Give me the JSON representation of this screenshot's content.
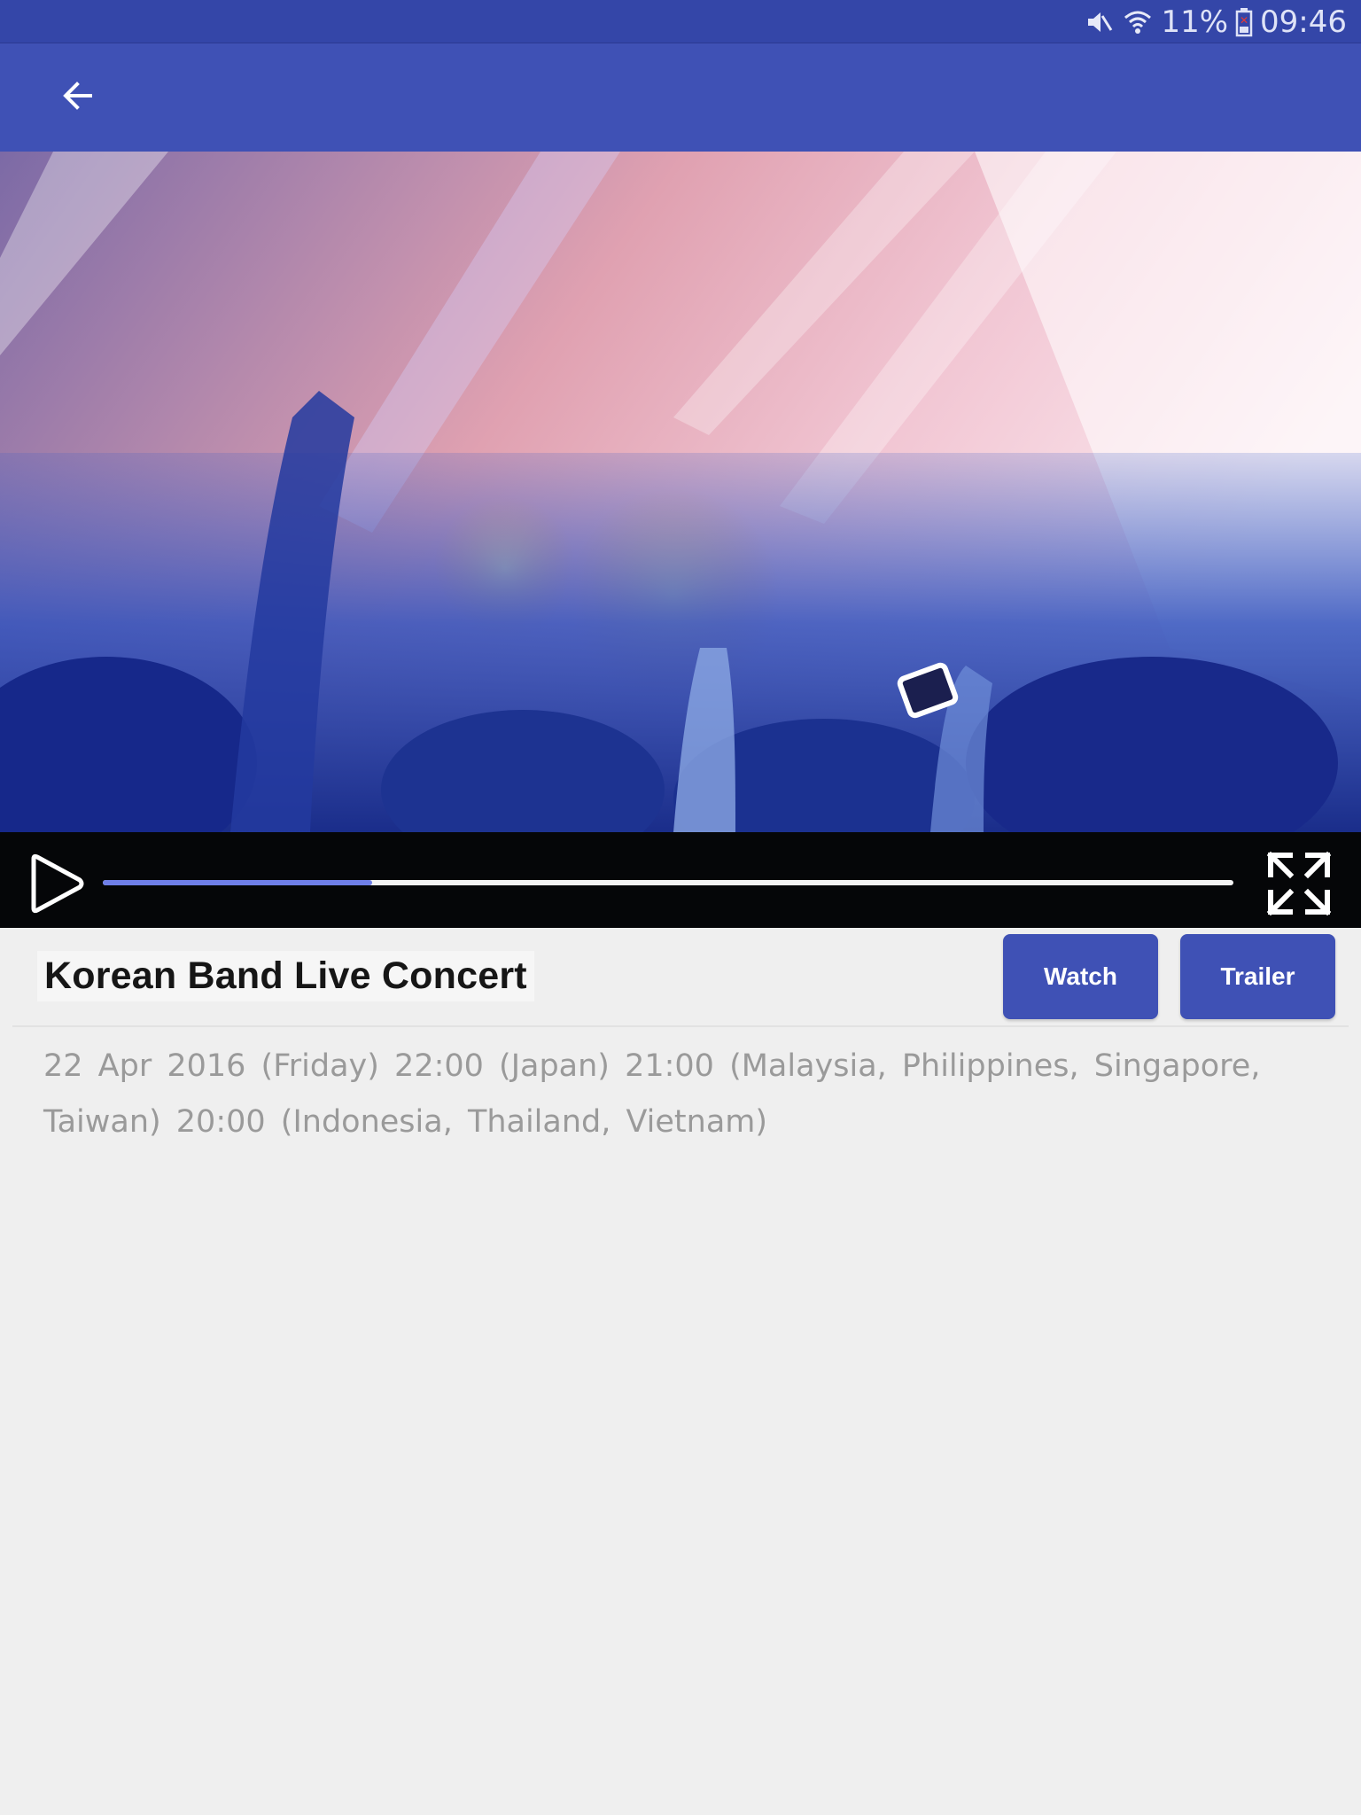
{
  "status_bar": {
    "battery": "11%",
    "time": "09:46",
    "icons": [
      "mute-icon",
      "wifi-icon",
      "battery-low-icon"
    ]
  },
  "app_bar": {
    "back_icon": "arrow-left-icon"
  },
  "video": {
    "scene": "concert-crowd-image",
    "progress_percent": 23.8,
    "icons": [
      "play-icon",
      "fullscreen-icon"
    ]
  },
  "event": {
    "title": "Korean Band Live Concert",
    "schedule": "22 Apr 2016 (Friday)  22:00 (Japan)  21:00 (Malaysia, Philippines, Singapore, Taiwan)  20:00 (Indonesia, Thailand, Vietnam)"
  },
  "actions": {
    "watch": "Watch",
    "trailer": "Trailer"
  },
  "colors": {
    "status_bar": "#3446a8",
    "app_bar": "#3f51b5",
    "accent": "#6f7fe8",
    "background": "#efefef"
  }
}
